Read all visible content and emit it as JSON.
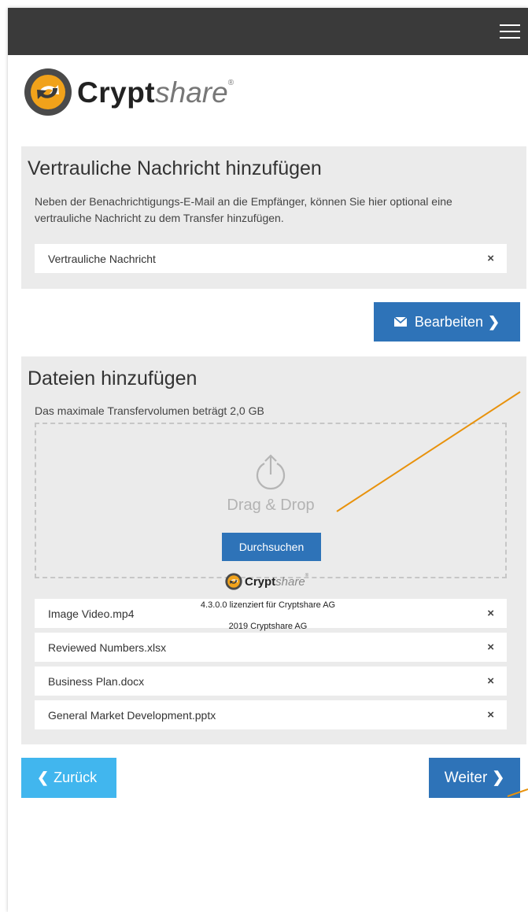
{
  "header": {
    "brand": {
      "bold": "Crypt",
      "light": "share",
      "reg": "®"
    }
  },
  "message_panel": {
    "title": "Vertrauliche Nachricht hinzufügen",
    "description": "Neben der Benachrichtigungs-E-Mail an die Empfänger, können Sie hier optional eine vertrauliche Nachricht zu dem Transfer hinzufügen.",
    "item_label": "Vertrauliche Nachricht",
    "remove_icon": "×"
  },
  "edit_button": {
    "label": "Bearbeiten",
    "icon": "envelope-icon",
    "chevron": "❯"
  },
  "files_panel": {
    "title": "Dateien hinzufügen",
    "limit_text": "Das maximale Transfervolumen beträgt 2,0 GB",
    "dropzone_text": "Drag & Drop",
    "browse_label": "Durchsuchen",
    "remove_icon": "×",
    "files": [
      {
        "name": "Image Video.mp4"
      },
      {
        "name": "Reviewed Numbers.xlsx"
      },
      {
        "name": "Business Plan.docx"
      },
      {
        "name": "General Market Development.pptx"
      }
    ]
  },
  "nav": {
    "back_label": "Zurück",
    "back_chevron": "❮",
    "next_label": "Weiter",
    "next_chevron": "❯"
  },
  "footer": {
    "brand_bold": "Crypt",
    "brand_light": "share",
    "brand_reg": "®",
    "license": "4.3.0.0 lizenziert für Cryptshare AG",
    "copyright": "2019 Cryptshare AG"
  },
  "colors": {
    "topbar": "#3a3a3a",
    "primary": "#2e73b8",
    "secondary": "#41b6ee",
    "panel": "#ebebeb",
    "annotation": "#e8920c"
  }
}
